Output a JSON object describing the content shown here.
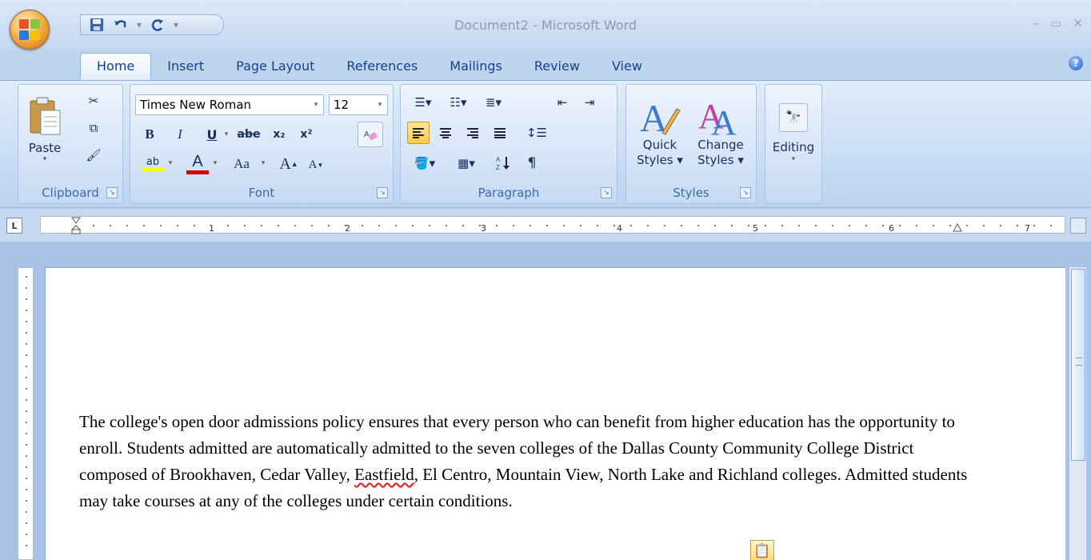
{
  "window": {
    "title": "Document2 - Microsoft Word",
    "minimize": "–",
    "restore": "▭",
    "close": "✕"
  },
  "quick_access": {
    "save_icon": "save-icon",
    "undo_icon": "undo-icon",
    "redo_icon": "redo-icon"
  },
  "tabs": [
    "Home",
    "Insert",
    "Page Layout",
    "References",
    "Mailings",
    "Review",
    "View"
  ],
  "help": "?",
  "ribbon": {
    "clipboard": {
      "label": "Clipboard",
      "paste_label": "Paste",
      "paste_arrow": "▾"
    },
    "font": {
      "label": "Font",
      "font_name": "Times New Roman",
      "font_size": "12",
      "bold": "B",
      "italic": "I",
      "underline": "U",
      "strike": "abe",
      "subscript": "x₂",
      "superscript": "x²",
      "change_case": "Aa",
      "grow": "A",
      "shrink": "A",
      "highlight": "ab",
      "font_color": "A"
    },
    "paragraph": {
      "label": "Paragraph"
    },
    "styles": {
      "label": "Styles",
      "quick_styles_line1": "Quick",
      "quick_styles_line2": "Styles",
      "change_styles_line1": "Change",
      "change_styles_line2": "Styles"
    },
    "editing": {
      "label": "Editing"
    }
  },
  "ruler": {
    "tab_selector": "L",
    "numbers": [
      "1",
      "2",
      "3",
      "4",
      "5",
      "6",
      "7"
    ]
  },
  "document": {
    "paragraph_part1": "The college's open door admissions policy ensures that every person who can benefit from higher education has the opportunity to enroll.  Students admitted are automatically admitted to the seven colleges of the Dallas County Community College District composed of Brookhaven, Cedar Valley, ",
    "misspelled": "Eastfield",
    "paragraph_part2": ", El Centro, Mountain View, North Lake and Richland colleges. Admitted students may take courses at any of the colleges under certain conditions."
  },
  "colors": {
    "accent": "#15428b",
    "ribbon_bg": "#c5dbf4",
    "highlight_yellow": "#ffff00",
    "font_red": "#d00000"
  }
}
